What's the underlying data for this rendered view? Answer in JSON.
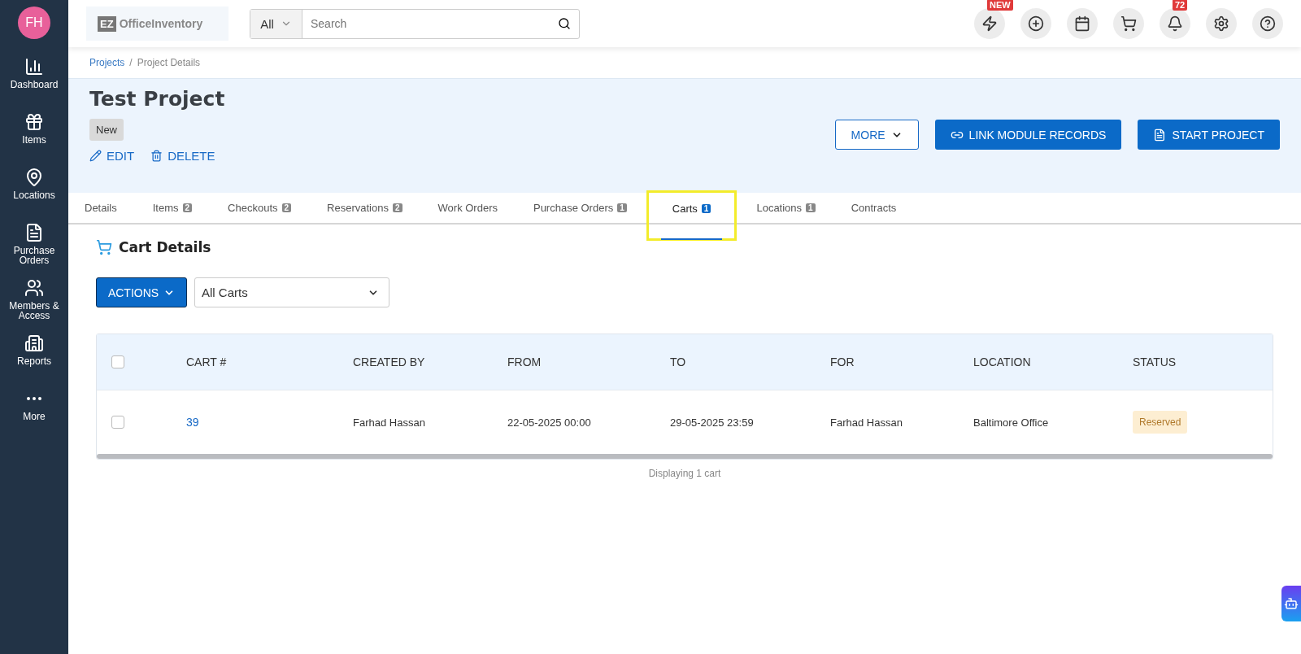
{
  "sidebar": {
    "avatar": "FH",
    "items": [
      {
        "label": "Dashboard"
      },
      {
        "label": "Items"
      },
      {
        "label": "Locations"
      },
      {
        "label": "Purchase Orders"
      },
      {
        "label": "Members & Access"
      },
      {
        "label": "Reports"
      },
      {
        "label": "More"
      }
    ]
  },
  "topbar": {
    "logo_mark": "EZ",
    "logo_text": "OfficeInventory",
    "search_scope": "All",
    "search_placeholder": "Search",
    "icons": [
      {
        "kind": "lightning",
        "badge": "NEW"
      },
      {
        "kind": "add"
      },
      {
        "kind": "calendar"
      },
      {
        "kind": "cart"
      },
      {
        "kind": "bell",
        "badge": "72"
      },
      {
        "kind": "settings"
      },
      {
        "kind": "help"
      }
    ]
  },
  "breadcrumb": {
    "items": [
      "Projects",
      "Project Details"
    ],
    "separator": "/"
  },
  "project": {
    "title": "Test Project",
    "status": "New",
    "actions": [
      "EDIT",
      "DELETE"
    ],
    "buttons": [
      {
        "label": "MORE",
        "kind": "outline"
      },
      {
        "label": "LINK MODULE RECORDS",
        "kind": "link"
      },
      {
        "label": "START PROJECT",
        "kind": "start"
      }
    ]
  },
  "tabs": [
    {
      "label": "Details",
      "selected": false
    },
    {
      "label": "Items",
      "count": "2",
      "selected": false
    },
    {
      "label": "Checkouts",
      "count": "2",
      "selected": false
    },
    {
      "label": "Reservations",
      "count": "2",
      "selected": false
    },
    {
      "label": "Work Orders",
      "selected": false
    },
    {
      "label": "Purchase Orders",
      "count": "1",
      "selected": false
    },
    {
      "label": "Carts",
      "count": "1",
      "selected": true,
      "highlighted": true
    },
    {
      "label": "Locations",
      "count": "1",
      "selected": false
    },
    {
      "label": "Contracts",
      "selected": false
    }
  ],
  "section": {
    "title": "Cart Details",
    "actions_button": "ACTIONS",
    "filter": "All Carts"
  },
  "table": {
    "select_all_checked": false,
    "columns": [
      "CART #",
      "CREATED BY",
      "FROM",
      "TO",
      "FOR",
      "LOCATION",
      "STATUS"
    ],
    "rows": [
      {
        "checked": false,
        "cells": [
          "39",
          "Farhad Hassan",
          "22-05-2025 00:00",
          "29-05-2025 23:59",
          "Farhad Hassan",
          "Baltimore Office",
          "Reserved"
        ]
      }
    ]
  },
  "footer": "Displaying 1 cart"
}
